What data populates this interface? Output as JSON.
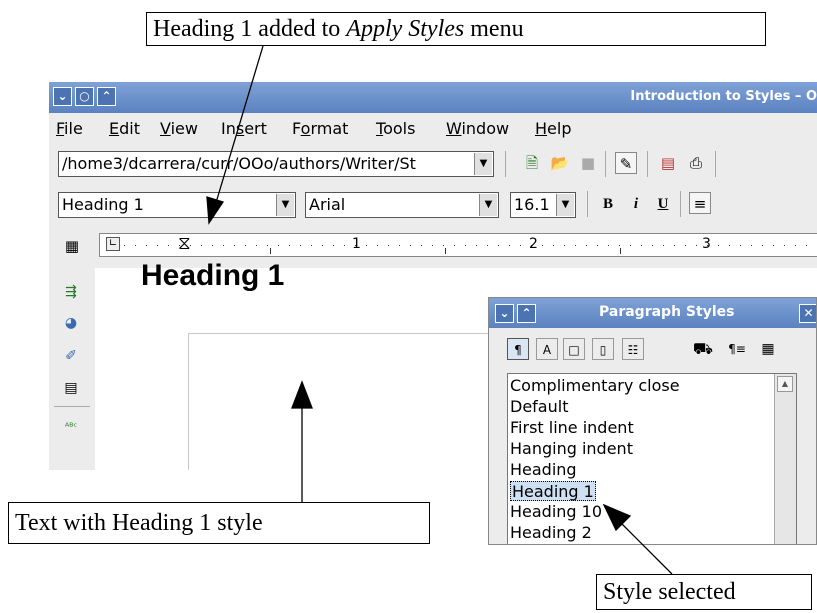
{
  "callouts": {
    "top_prefix": "Heading 1 added to ",
    "top_italic": "Apply Styles",
    "top_suffix": " menu",
    "left": "Text with Heading 1 style",
    "right": "Style selected"
  },
  "window": {
    "title": "Introduction to Styles – O",
    "buttons": [
      "⌄",
      "○",
      "⌃"
    ]
  },
  "menu": [
    "File",
    "Edit",
    "View",
    "Insert",
    "Format",
    "Tools",
    "Window",
    "Help"
  ],
  "menu_underline": [
    "F",
    "E",
    "V",
    "s",
    "o",
    "T",
    "W",
    "H"
  ],
  "toolbar1": {
    "path_value": "/home3/dcarrera/curr/OOo/authors/Writer/St"
  },
  "toolbar2": {
    "style_value": "Heading 1",
    "font_value": "Arial",
    "size_value": "16.1",
    "bold": "B",
    "italic": "i",
    "underline": "U"
  },
  "ruler": {
    "numbers": [
      "1",
      "2",
      "3"
    ]
  },
  "document": {
    "heading_text": "Heading 1"
  },
  "stylist": {
    "title": "Paragraph Styles",
    "items": [
      "Complimentary close",
      "Default",
      "First line indent",
      "Hanging indent",
      "Heading",
      "Heading 1",
      "Heading 10",
      "Heading 2"
    ],
    "selected": "Heading 1"
  }
}
